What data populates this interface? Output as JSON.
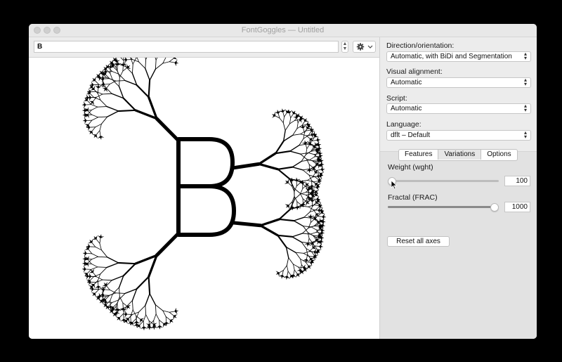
{
  "window": {
    "title": "FontGoggles — Untitled"
  },
  "input": {
    "text": "B"
  },
  "icons": {
    "gear": "gear-icon",
    "chevron": "chevron-down-icon",
    "stepper": "up-down-stepper-icon",
    "cursor": "mouse-pointer-icon"
  },
  "sidebar": {
    "direction": {
      "label": "Direction/orientation:",
      "value": "Automatic, with BiDi and Segmentation"
    },
    "alignment": {
      "label": "Visual alignment:",
      "value": "Automatic"
    },
    "script": {
      "label": "Script:",
      "value": "Automatic"
    },
    "language": {
      "label": "Language:",
      "value": "dflt – Default"
    }
  },
  "tabs": [
    {
      "label": "Features"
    },
    {
      "label": "Variations",
      "selected": true
    },
    {
      "label": "Options"
    }
  ],
  "variations": {
    "weight": {
      "label": "Weight (wght)",
      "value": "100",
      "fraction": 0.0
    },
    "fractal": {
      "label": "Fractal (FRAC)",
      "value": "1000",
      "fraction": 1.0
    },
    "reset_label": "Reset all axes"
  },
  "colors": {
    "glyph": "#000000",
    "window_bg": "#ececec",
    "canvas_bg": "#ffffff"
  }
}
